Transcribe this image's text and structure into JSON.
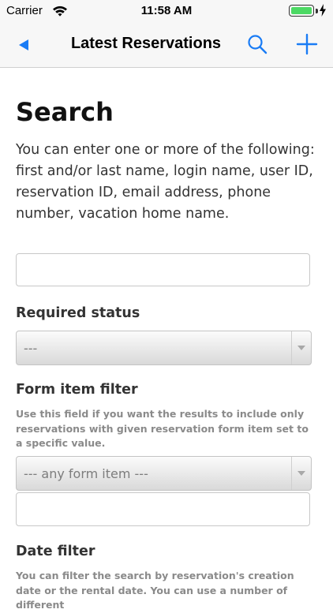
{
  "status_bar": {
    "carrier": "Carrier",
    "time": "11:58 AM"
  },
  "nav": {
    "title": "Latest Reservations"
  },
  "page": {
    "title": "Search",
    "intro": "You can enter one or more of the following: first and/or last name, login name, user ID, reservation ID, email address, phone number, vacation home name."
  },
  "search": {
    "value": "",
    "placeholder": ""
  },
  "required_status": {
    "label": "Required status",
    "selected": "---"
  },
  "form_item_filter": {
    "label": "Form item filter",
    "help": "Use this field if you want the results to include only reservations with given reservation form item set to a specific value.",
    "selected": "--- any form item ---",
    "value_input": ""
  },
  "date_filter": {
    "label": "Date filter",
    "help": "You can filter the search by reservation's creation date or the rental date. You can use a number of different"
  },
  "colors": {
    "accent": "#1a7cf5",
    "battery": "#4cd964"
  }
}
